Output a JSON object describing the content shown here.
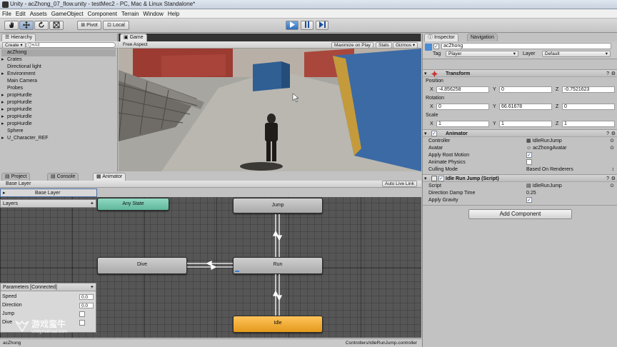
{
  "window": {
    "title": "Unity - acZhong_07_flow.unity - testMec2 - PC, Mac & Linux Standalone*"
  },
  "menu": [
    "File",
    "Edit",
    "Assets",
    "GameObject",
    "Component",
    "Terrain",
    "Window",
    "Help"
  ],
  "toolbar": {
    "pivot": "Pivot",
    "local": "Local"
  },
  "hierarchy": {
    "tab": "Hierarchy",
    "create": "Create",
    "search_placeholder": "Q▾All",
    "items": [
      "acZhong",
      "Crates",
      "Directional light",
      "Environment",
      "Main Camera",
      "Probes",
      "propHurdle",
      "propHurdle",
      "propHurdle",
      "propHurdle",
      "propHurdle",
      "Sphere",
      "U_Character_REF"
    ]
  },
  "game": {
    "tab": "Game",
    "aspect": "Free Aspect",
    "maximize": "Maximize on Play",
    "stats": "Stats",
    "gizmos": "Gizmos"
  },
  "bottom_tabs": [
    "Project",
    "Console",
    "Animator"
  ],
  "animator": {
    "layer_name": "Base Layer",
    "auto_live_link": "Auto Live Link",
    "layers_title": "Layers",
    "layers_add": "+",
    "states": {
      "any": "Any State",
      "jump": "Jump",
      "dive": "Dive",
      "run": "Run",
      "idle": "Idle"
    },
    "parameters_title": "Parameters [Connected]",
    "parameters_add": "+",
    "parameters": [
      {
        "name": "Speed",
        "value": "0.0"
      },
      {
        "name": "Direction",
        "value": "0.0"
      },
      {
        "name": "Jump",
        "value": ""
      },
      {
        "name": "Dive",
        "value": ""
      }
    ],
    "status_left": "acZhong",
    "status_right": "Controllers/IdleRunJump.controller"
  },
  "watermark": {
    "main": "游戏蛮牛",
    "sub": "Unitymanual.com"
  },
  "inspector": {
    "tabs": [
      "Inspector",
      "Navigation"
    ],
    "object_name": "acZhong",
    "tag_label": "Tag",
    "tag_value": "Player",
    "layer_label": "Layer",
    "layer_value": "Default",
    "transform": {
      "title": "Transform",
      "position_label": "Position",
      "rotation_label": "Rotation",
      "scale_label": "Scale",
      "position": [
        "-4.856258",
        "0",
        "-0.7521623"
      ],
      "rotation": [
        "0",
        "66.61678",
        "0"
      ],
      "scale": [
        "1",
        "1",
        "1"
      ],
      "axes": [
        "X",
        "Y",
        "Z"
      ]
    },
    "animator": {
      "title": "Animator",
      "rows": [
        {
          "label": "Controller",
          "value": "IdleRunJump"
        },
        {
          "label": "Avatar",
          "value": "acZhongAvatar"
        },
        {
          "label": "Apply Root Motion",
          "value": "✓"
        },
        {
          "label": "Animate Physics",
          "value": ""
        },
        {
          "label": "Culling Mode",
          "value": "Based On Renderers"
        }
      ]
    },
    "script": {
      "title": "Idle Run Jump (Script)",
      "rows": [
        {
          "label": "Script",
          "value": "IdleRunJump"
        },
        {
          "label": "Direction Damp Time",
          "value": "0.25"
        },
        {
          "label": "Apply Gravity",
          "value": "✓"
        }
      ]
    },
    "add_component": "Add Component"
  }
}
